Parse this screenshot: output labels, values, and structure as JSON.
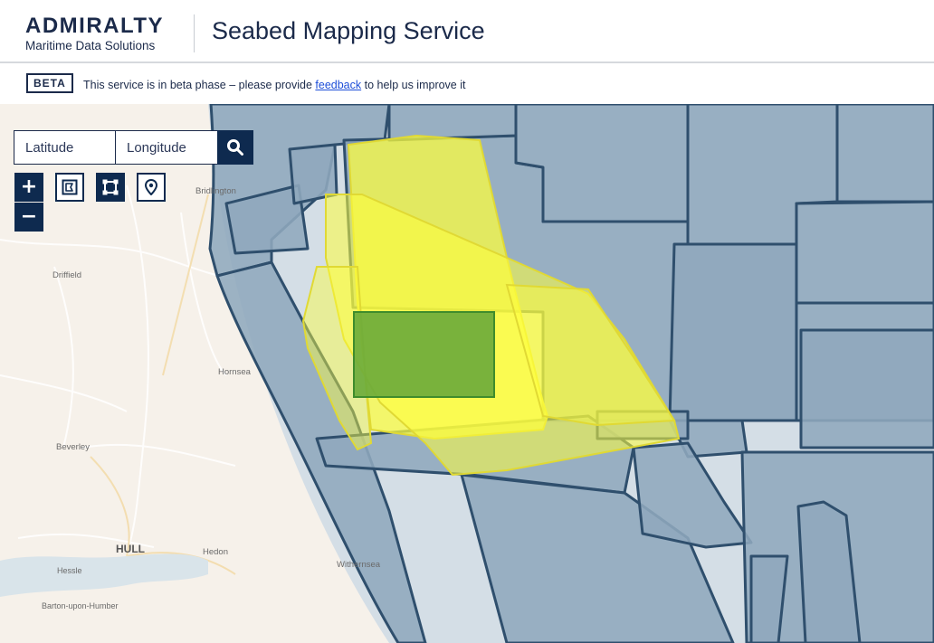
{
  "header": {
    "brand_title": "ADMIRALTY",
    "brand_subtitle": "Maritime Data Solutions",
    "service_title": "Seabed Mapping Service"
  },
  "beta_banner": {
    "tag": "BETA",
    "text_before": "This service is in beta phase – please provide",
    "link_text": "feedback",
    "text_after": "to help us improve it"
  },
  "search": {
    "latitude_placeholder": "Latitude",
    "longitude_placeholder": "Longitude",
    "icon": "search-icon"
  },
  "map_controls": {
    "zoom_in_label": "+",
    "zoom_out_label": "−",
    "tools": [
      {
        "name": "draw-polygon-tool",
        "icon": "polygon-icon",
        "active": false
      },
      {
        "name": "draw-box-tool",
        "icon": "bounding-box-icon",
        "active": true
      },
      {
        "name": "place-marker-tool",
        "icon": "map-pin-icon",
        "active": false
      }
    ]
  },
  "map": {
    "places": [
      {
        "name": "Bridlington"
      },
      {
        "name": "Driffield"
      },
      {
        "name": "Hornsea"
      },
      {
        "name": "Beverley"
      },
      {
        "name": "HULL"
      },
      {
        "name": "Hedon"
      },
      {
        "name": "Withernsea"
      },
      {
        "name": "Hessle"
      },
      {
        "name": "Barton-upon-Humber"
      }
    ],
    "colors": {
      "land": "#f6f1ea",
      "coverage_fill": "#8fa9bd",
      "coverage_stroke": "#2f4f6d",
      "highlight_fill": "#ffff3c",
      "selection_fill": "#6aaa3a",
      "selection_stroke": "#3f8c2c",
      "water": "#d9e4ea"
    }
  }
}
